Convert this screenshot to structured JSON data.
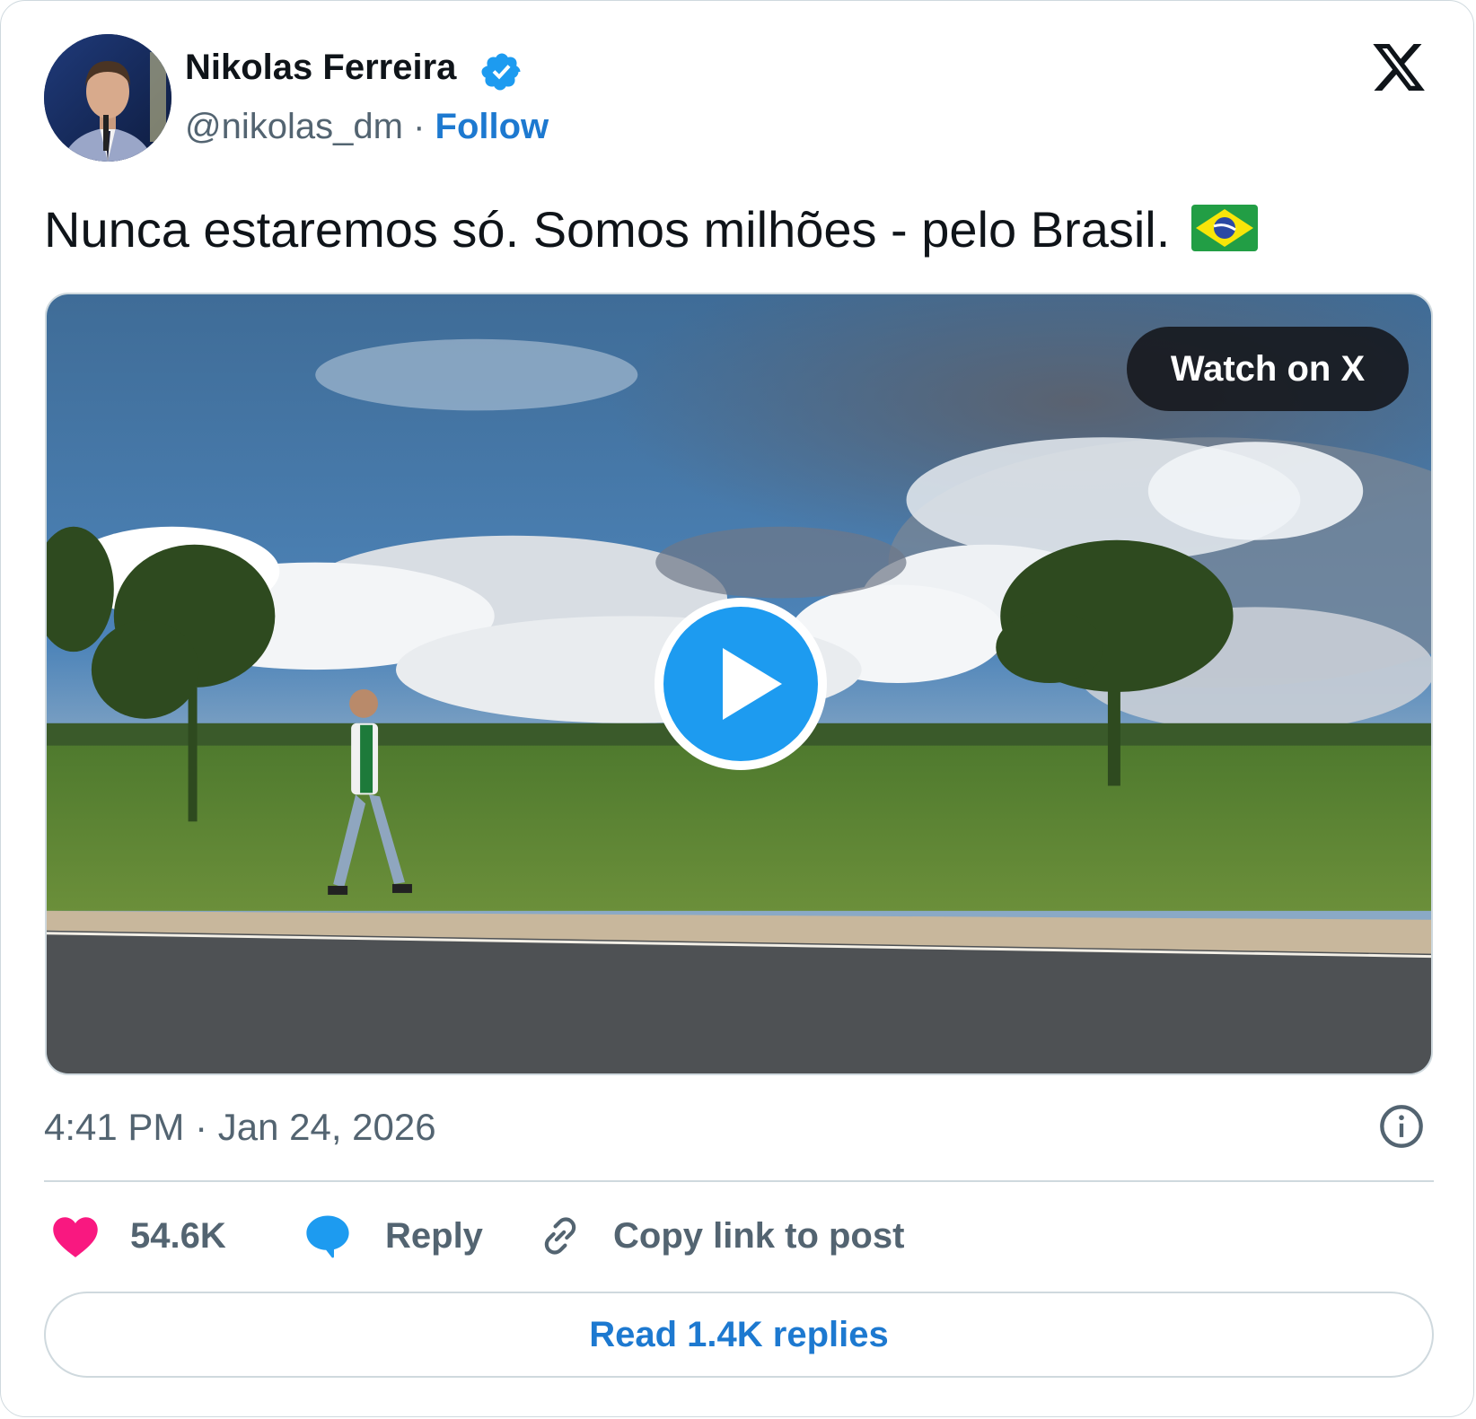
{
  "author": {
    "name": "Nikolas Ferreira",
    "handle": "@nikolas_dm",
    "separator": "·",
    "follow_label": "Follow",
    "verified": true
  },
  "post": {
    "text": "Nunca estaremos só. Somos milhões - pelo Brasil.",
    "emoji": "flag-brazil"
  },
  "media": {
    "watch_label": "Watch on X",
    "type": "video"
  },
  "meta": {
    "timestamp": "4:41 PM · Jan 24, 2026"
  },
  "actions": {
    "like_count": "54.6K",
    "reply_label": "Reply",
    "copy_label": "Copy link to post"
  },
  "footer": {
    "read_replies_label": "Read 1.4K replies"
  },
  "colors": {
    "link_blue": "#1d79d0",
    "like_pink": "#f91880",
    "reply_blue": "#1d9bf0",
    "muted_gray": "#536471",
    "border": "#cfd9de"
  },
  "icons": [
    "verified-badge-icon",
    "x-logo-icon",
    "play-icon",
    "info-icon",
    "heart-icon",
    "reply-bubble-icon",
    "link-icon"
  ]
}
